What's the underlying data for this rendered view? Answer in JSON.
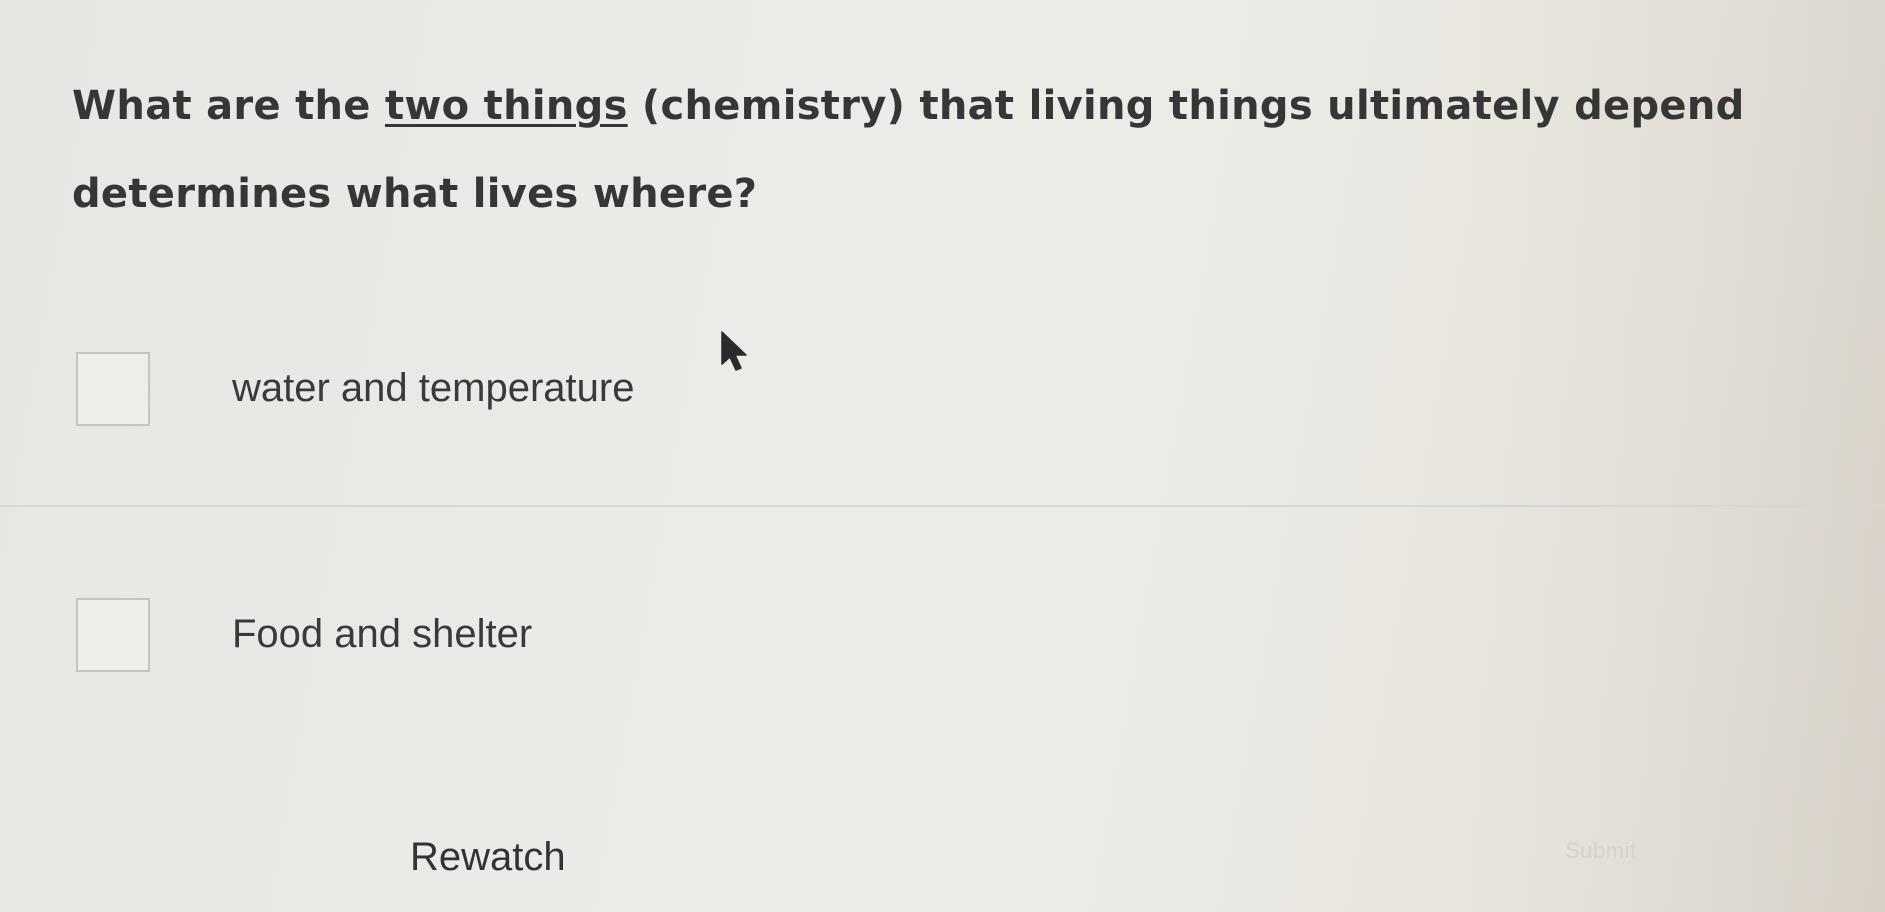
{
  "question": {
    "prefix": "What are the ",
    "underlined": "two things",
    "suffix": " (chemistry) that living things ultimately depend determines what lives where?"
  },
  "options": [
    {
      "label": "water and temperature",
      "checked": false
    },
    {
      "label": "Food and shelter",
      "checked": false
    }
  ],
  "actions": {
    "rewatch_label": "Rewatch",
    "submit_label": "Submit"
  },
  "cursor_icon": "arrow-pointer-icon"
}
